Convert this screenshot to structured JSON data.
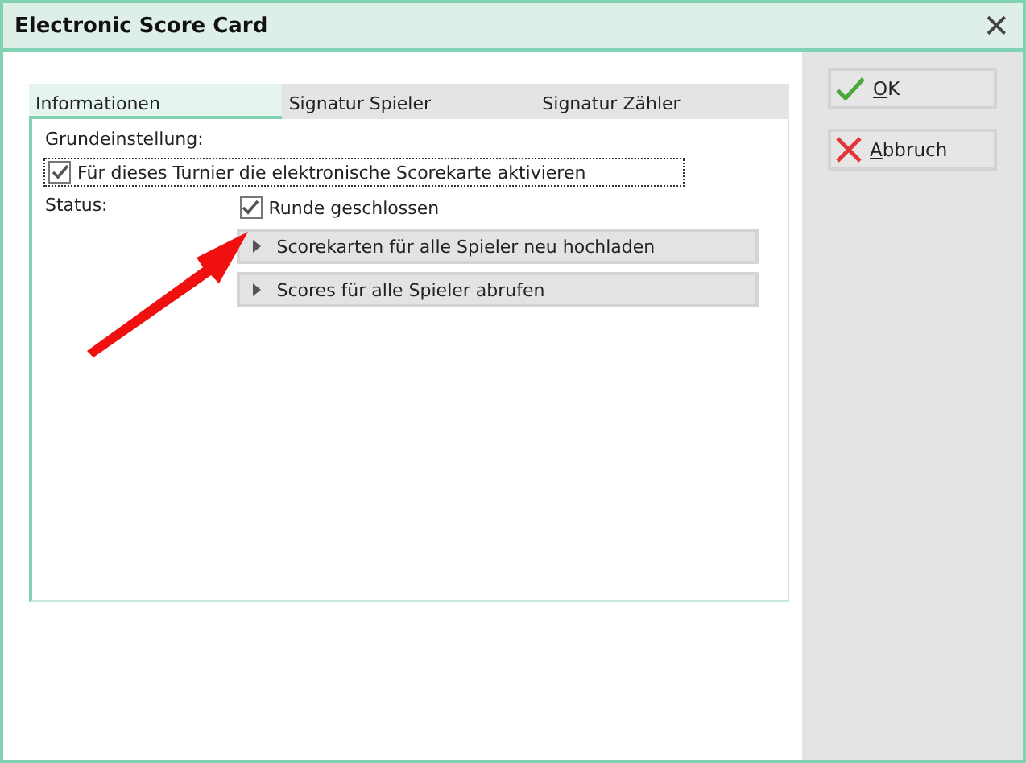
{
  "window": {
    "title": "Electronic Score Card",
    "close": "✕"
  },
  "tabs": [
    {
      "label": "Informationen",
      "selected": true
    },
    {
      "label": "Signatur Spieler",
      "selected": false
    },
    {
      "label": "Signatur Zähler",
      "selected": false
    }
  ],
  "section_label": "Grundeinstellung:",
  "activate": {
    "label": "Für dieses Turnier die elektronische Scorekarte aktivieren",
    "checked": true,
    "focused": true
  },
  "status_label": "Status:",
  "round_closed": {
    "label": "Runde geschlossen",
    "checked": true
  },
  "actions": [
    "Scorekarten für alle Spieler neu hochladen",
    "Scores für alle Spieler abrufen"
  ],
  "buttons": [
    {
      "label": "OK",
      "kind": "ok"
    },
    {
      "label": "Abbruch",
      "kind": "cancel"
    }
  ]
}
